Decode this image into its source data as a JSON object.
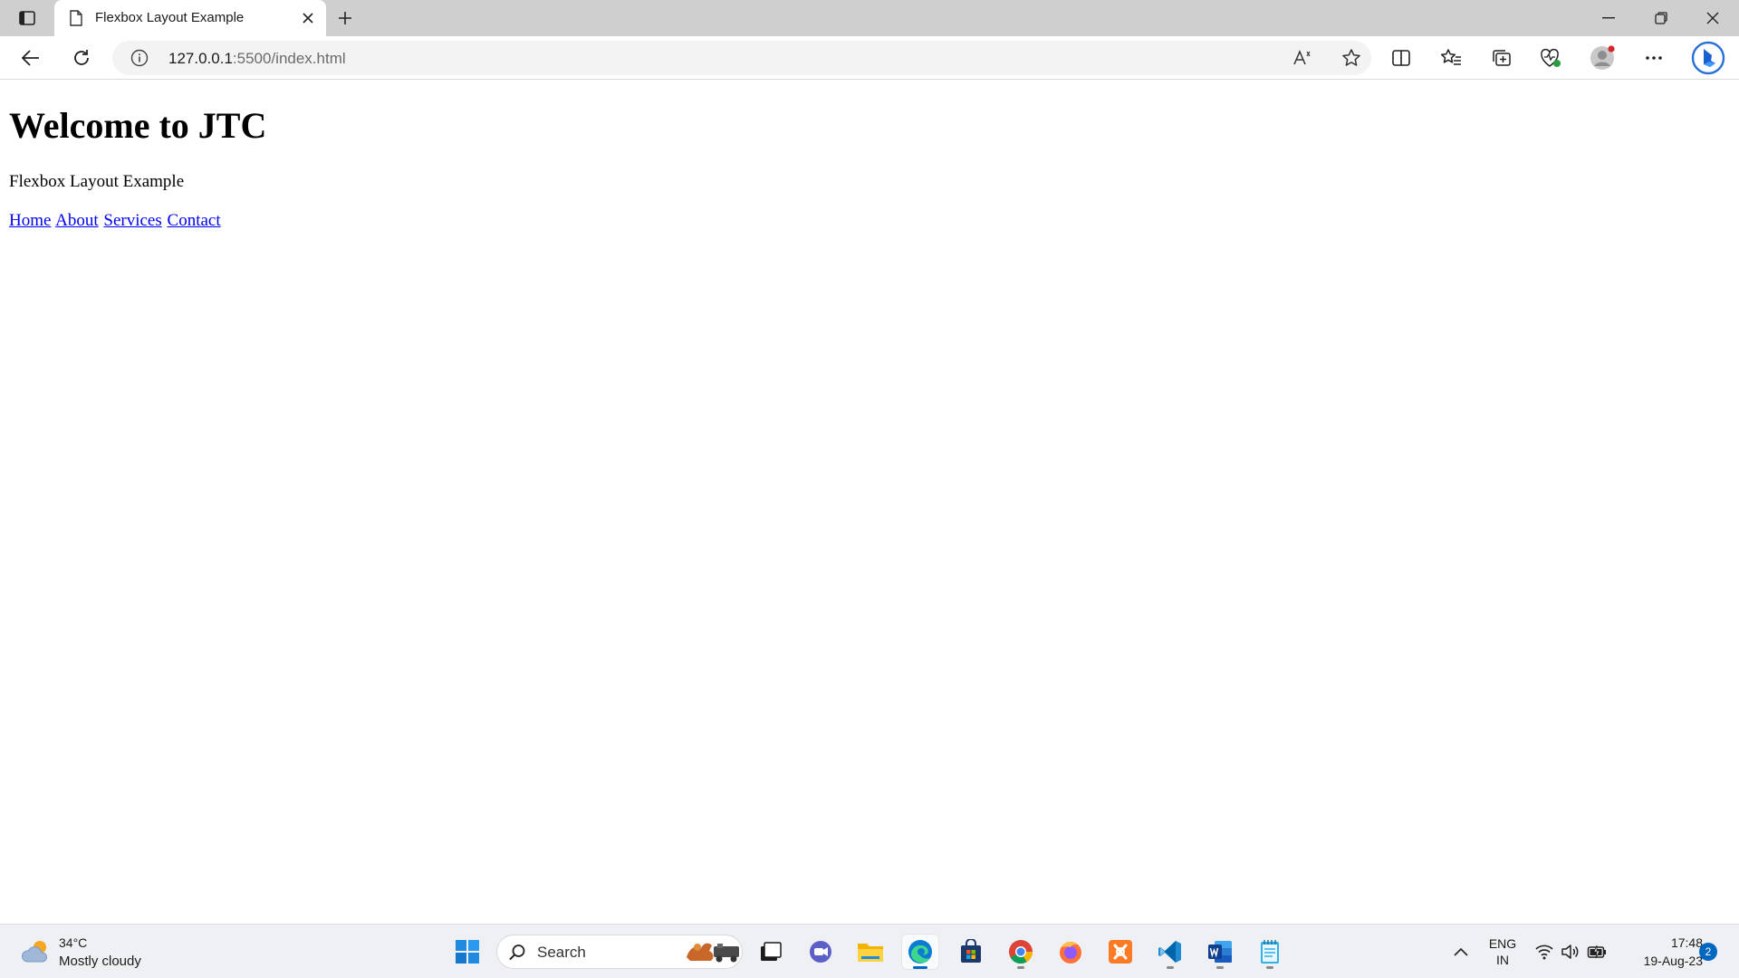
{
  "browser": {
    "tab_title": "Flexbox Layout Example",
    "url_host": "127.0.0.1",
    "url_path": ":5500/index.html"
  },
  "page": {
    "heading": "Welcome to JTC",
    "subtitle": "Flexbox Layout Example",
    "nav": [
      "Home",
      "About",
      "Services",
      "Contact"
    ]
  },
  "taskbar": {
    "weather_temp": "34°C",
    "weather_desc": "Mostly cloudy",
    "search_label": "Search",
    "lang_line1": "ENG",
    "lang_line2": "IN",
    "time": "17:48",
    "date": "19-Aug-23",
    "notification_count": "2"
  },
  "colors": {
    "link": "#0000ee",
    "accent": "#0067c0",
    "titlebar": "#cfcfcf"
  }
}
